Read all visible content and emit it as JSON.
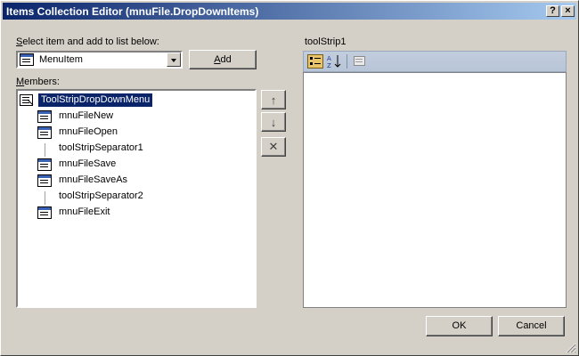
{
  "window": {
    "title": "Items Collection Editor (mnuFile.DropDownItems)"
  },
  "title_buttons": {
    "help": "?",
    "close": "×"
  },
  "select_item": {
    "label_accel": "S",
    "label_rest": "elect item and add to list below:",
    "combo_value": "MenuItem",
    "add_accel": "A",
    "add_rest": "dd"
  },
  "members": {
    "label_accel": "M",
    "label_rest": "embers:",
    "items": [
      {
        "label": "ToolStripDropDownMenu",
        "icon": "dropdown-menu-icon"
      },
      {
        "label": "mnuFileNew",
        "icon": "menu-item-icon"
      },
      {
        "label": "mnuFileOpen",
        "icon": "menu-item-icon"
      },
      {
        "label": "toolStripSeparator1",
        "icon": "separator-icon"
      },
      {
        "label": "mnuFileSave",
        "icon": "menu-item-icon"
      },
      {
        "label": "mnuFileSaveAs",
        "icon": "menu-item-icon"
      },
      {
        "label": "toolStripSeparator2",
        "icon": "separator-icon"
      },
      {
        "label": "mnuFileExit",
        "icon": "menu-item-icon"
      }
    ],
    "selected_index": 0
  },
  "side_buttons": {
    "up": "↑",
    "down": "↓",
    "delete": "✕"
  },
  "properties": {
    "title": "toolStrip1",
    "toolbar": [
      "categorized-icon",
      "alphabetical-icon",
      "property-pages-icon"
    ]
  },
  "footer": {
    "ok": "OK",
    "cancel": "Cancel"
  },
  "colors": {
    "selection": "#0a246a",
    "face": "#d4d0c8",
    "toolbar": "#c2cddd"
  }
}
